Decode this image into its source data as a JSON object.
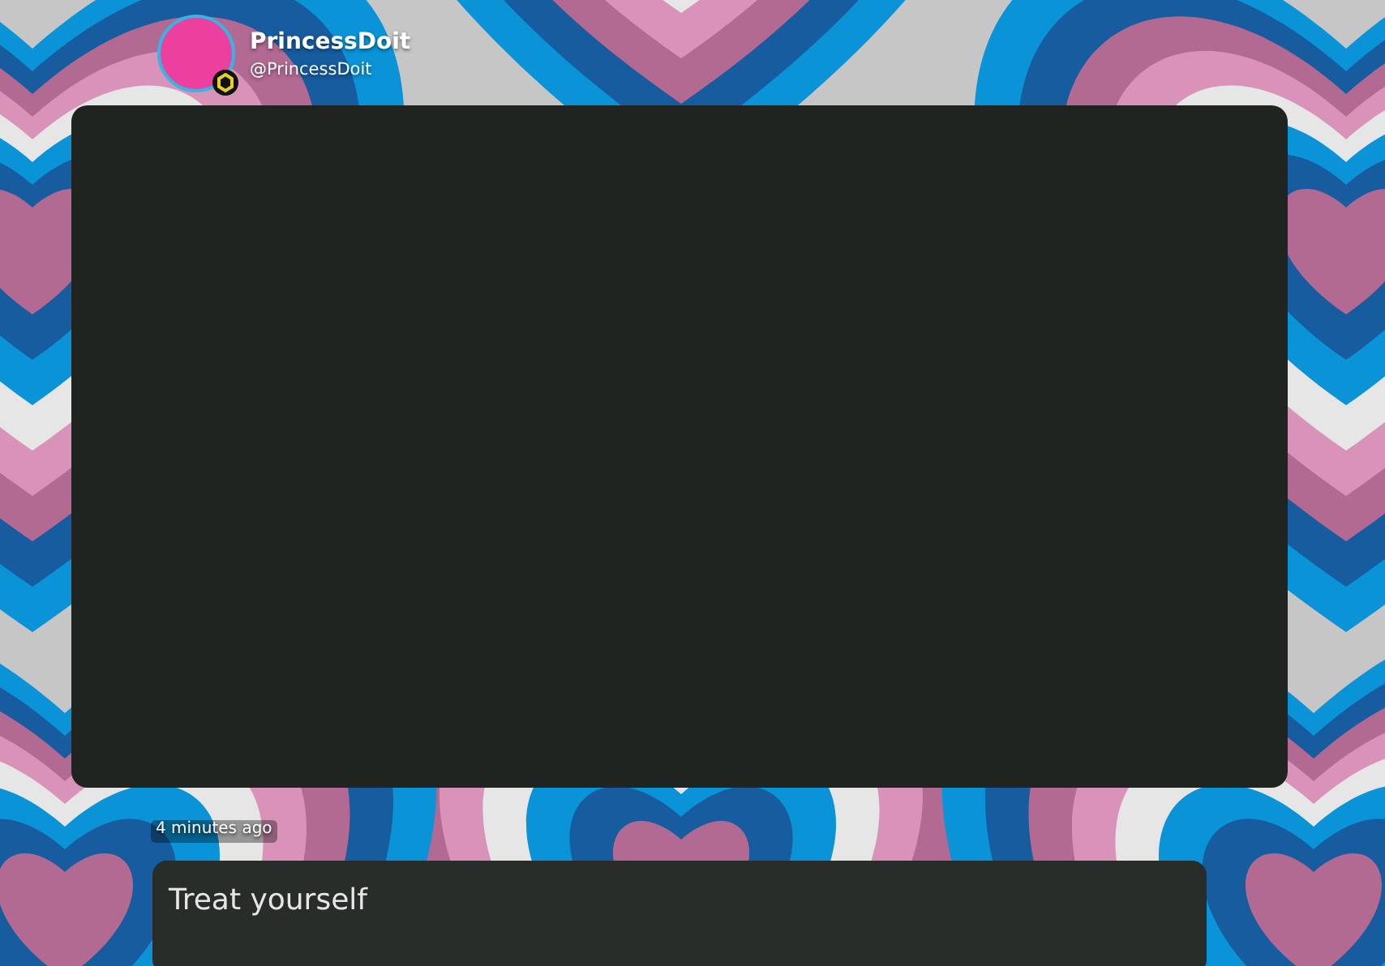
{
  "author": {
    "display_name": "PrincessDoit",
    "handle": "@PrincessDoit"
  },
  "post": {
    "timestamp": "4 minutes ago",
    "message": "Treat yourself"
  }
}
